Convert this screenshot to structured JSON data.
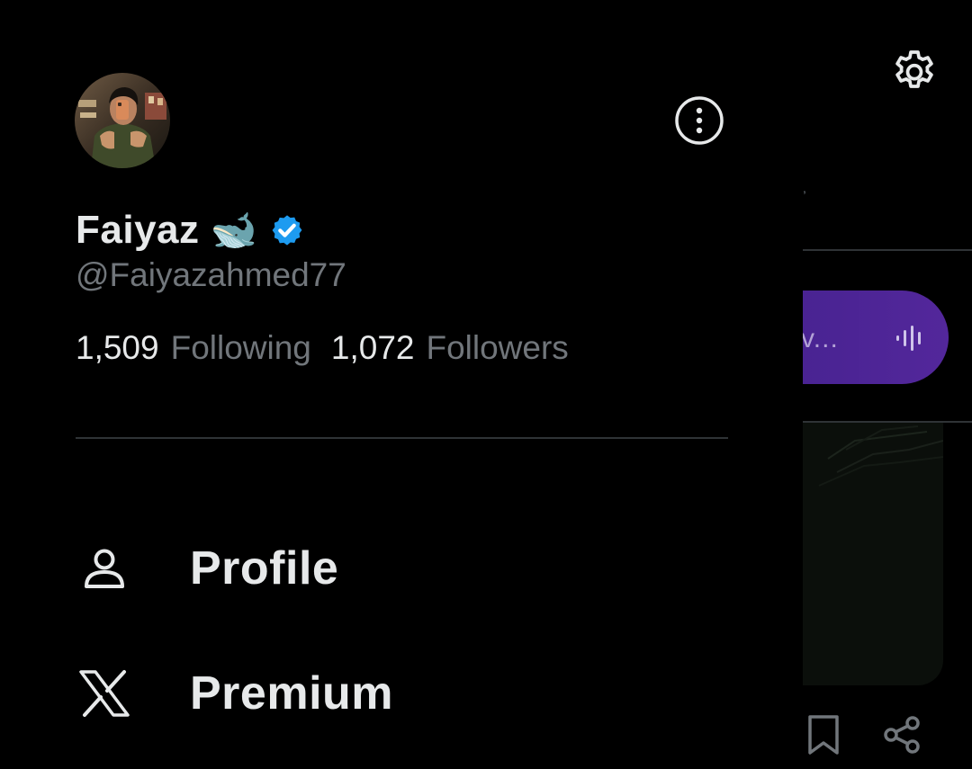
{
  "profile": {
    "display_name": "Faiyaz",
    "name_emoji": "🐋",
    "handle": "@Faiyazahmed77",
    "following_count": "1,509",
    "following_label": "Following",
    "followers_count": "1,072",
    "followers_label": "Followers",
    "verified": true
  },
  "menu": {
    "items": [
      {
        "label": "Profile",
        "icon": "person-icon"
      },
      {
        "label": "Premium",
        "icon": "x-logo-icon"
      }
    ]
  },
  "background": {
    "grok_pill_text": "v..."
  },
  "colors": {
    "background": "#000000",
    "primary_text": "#e7e9ea",
    "secondary_text": "#71767b",
    "divider": "#2f3336",
    "verified_blue": "#1d9bf0",
    "grok_purple": "#4b2494"
  }
}
